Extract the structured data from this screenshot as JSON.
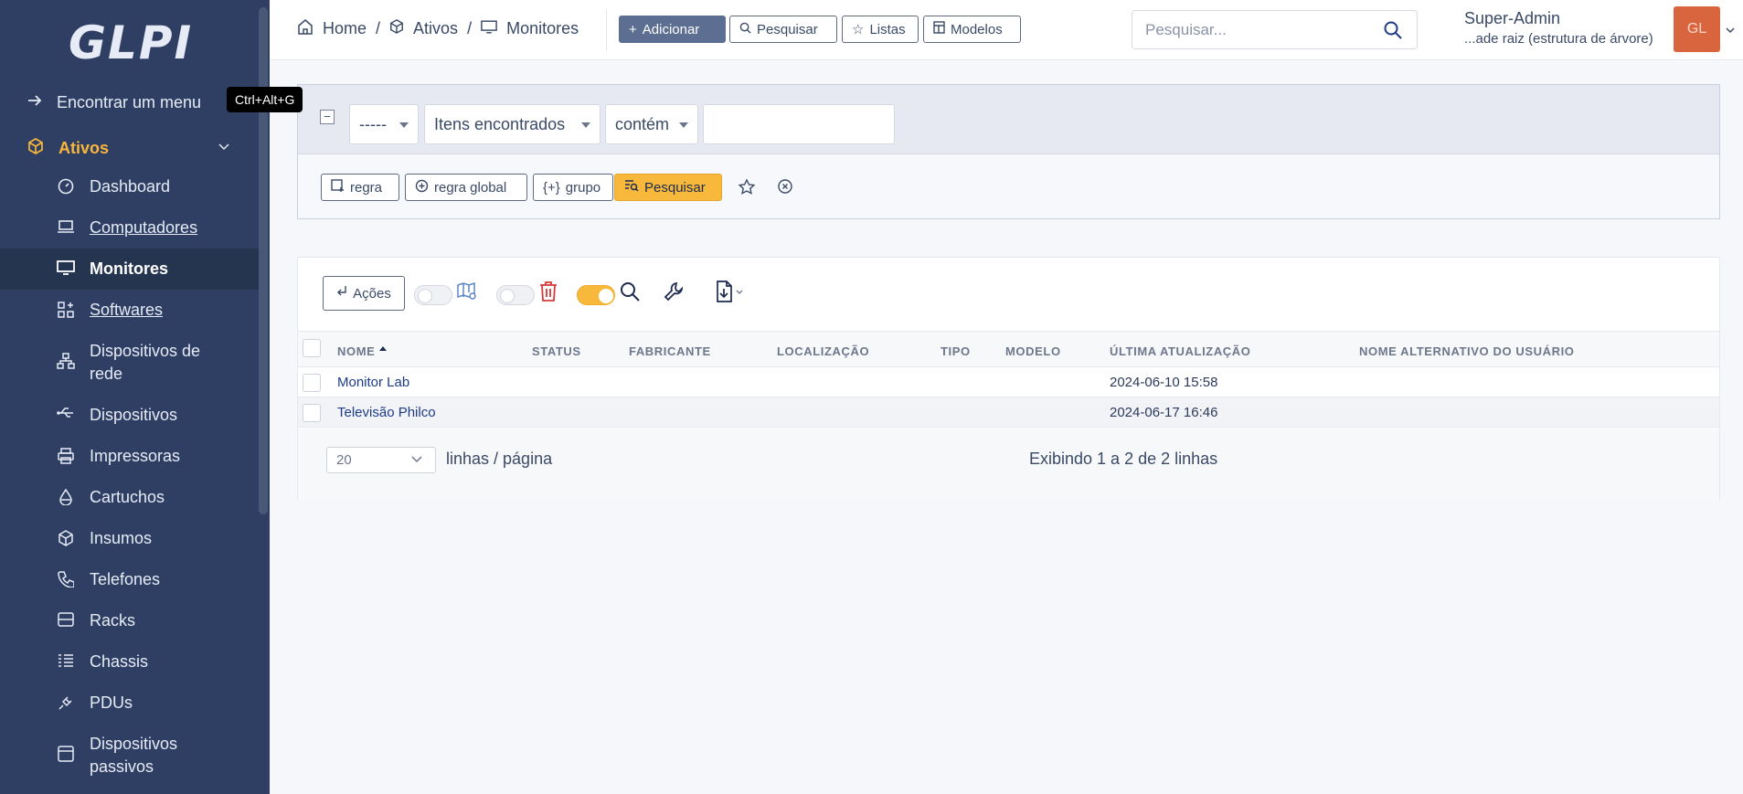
{
  "sidebar": {
    "logo": "GLPI",
    "find_menu": "Encontrar um menu",
    "shortcut": "Ctrl+Alt+G",
    "section": "Ativos",
    "items": [
      {
        "label": "Dashboard",
        "icon": "gauge-icon"
      },
      {
        "label": "Computadores",
        "icon": "laptop-icon"
      },
      {
        "label": "Monitores",
        "icon": "monitor-icon"
      },
      {
        "label": "Softwares",
        "icon": "apps-icon"
      },
      {
        "label": "Dispositivos de rede",
        "icon": "network-icon"
      },
      {
        "label": "Dispositivos",
        "icon": "usb-icon"
      },
      {
        "label": "Impressoras",
        "icon": "printer-icon"
      },
      {
        "label": "Cartuchos",
        "icon": "droplet-icon"
      },
      {
        "label": "Insumos",
        "icon": "box-icon"
      },
      {
        "label": "Telefones",
        "icon": "phone-icon"
      },
      {
        "label": "Racks",
        "icon": "server-icon"
      },
      {
        "label": "Chassis",
        "icon": "list-icon"
      },
      {
        "label": "PDUs",
        "icon": "plug-icon"
      },
      {
        "label": "Dispositivos passivos",
        "icon": "device-icon"
      }
    ]
  },
  "header": {
    "breadcrumb": [
      "Home",
      "Ativos",
      "Monitores"
    ],
    "buttons": {
      "add": "Adicionar",
      "search": "Pesquisar",
      "lists": "Listas",
      "models": "Modelos"
    },
    "search_placeholder": "Pesquisar...",
    "user_name": "Super-Admin",
    "entity": "...ade raiz (estrutura de árvore)",
    "avatar": "GL"
  },
  "criteria": {
    "field1": "-----",
    "field2": "Itens encontrados",
    "operator": "contém",
    "value": "",
    "buttons": {
      "rule": "regra",
      "global_rule": "regra global",
      "group": "grupo",
      "search": "Pesquisar"
    }
  },
  "results": {
    "actions": "Ações",
    "columns": [
      "NOME",
      "STATUS",
      "FABRICANTE",
      "LOCALIZAÇÃO",
      "TIPO",
      "MODELO",
      "ÚLTIMA ATUALIZAÇÃO",
      "NOME ALTERNATIVO DO USUÁRIO"
    ],
    "rows": [
      {
        "name": "Monitor Lab",
        "updated": "2024-06-10 15:58"
      },
      {
        "name": "Televisão Philco",
        "updated": "2024-06-17 16:46"
      }
    ],
    "page_size": "20",
    "page_size_label": "linhas / página",
    "pager_info": "Exibindo 1 a 2 de 2 linhas"
  },
  "colors": {
    "sidebar": "#2f3f64",
    "accent": "#f8b83c",
    "avatar": "#d9653f"
  }
}
